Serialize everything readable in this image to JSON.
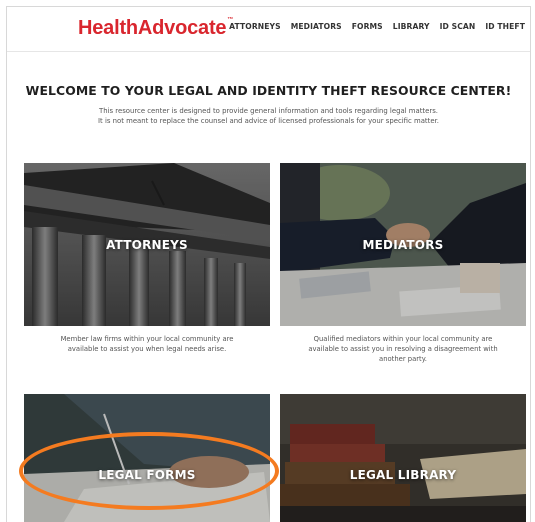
{
  "brand": {
    "name": "HealthAdvocate",
    "tm": "™",
    "color": "#d9262e"
  },
  "nav": [
    {
      "label": "ATTORNEYS"
    },
    {
      "label": "MEDIATORS"
    },
    {
      "label": "FORMS"
    },
    {
      "label": "LIBRARY"
    },
    {
      "label": "ID SCAN"
    },
    {
      "label": "ID THEFT"
    }
  ],
  "main": {
    "headline": "WELCOME TO YOUR LEGAL AND IDENTITY THEFT RESOURCE CENTER!",
    "intro": "This resource center is designed to provide general information and tools regarding legal matters. It is not meant to replace the counsel and advice of licensed professionals for your specific matter."
  },
  "tiles": [
    {
      "label": "ATTORNEYS",
      "description": "Member law firms within your local community are available to assist you when legal needs arise."
    },
    {
      "label": "MEDIATORS",
      "description": "Qualified mediators within your local community are available to assist you in resolving a disagreement with another party."
    },
    {
      "label": "LEGAL FORMS"
    },
    {
      "label": "LEGAL LIBRARY"
    }
  ],
  "highlight_color": "#f47b20"
}
